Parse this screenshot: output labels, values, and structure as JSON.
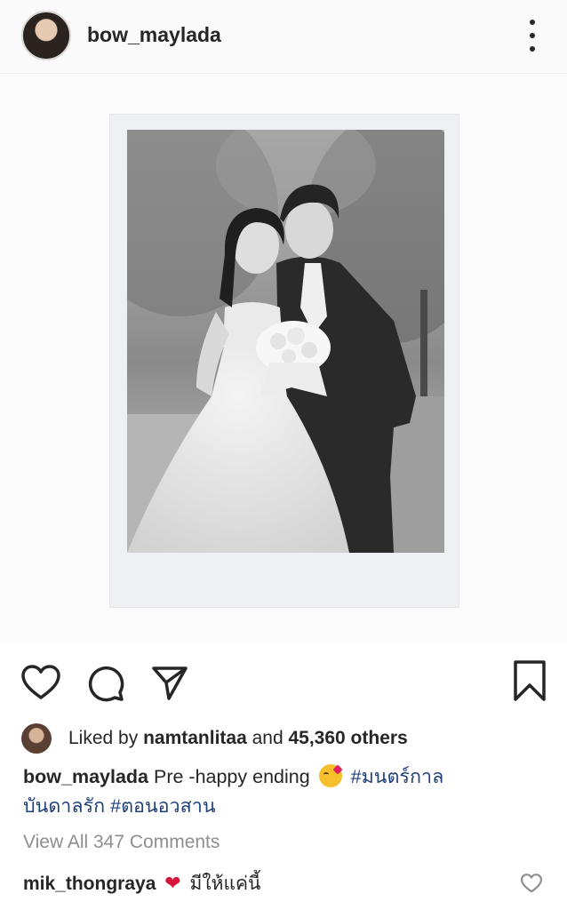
{
  "header": {
    "username": "bow_maylada"
  },
  "icons": {
    "more": "more-vertical-icon",
    "like": "heart-icon",
    "comment": "comment-icon",
    "share": "paper-plane-icon",
    "save": "bookmark-icon"
  },
  "likes": {
    "prefix": "Liked by ",
    "liker": "namtanlitaa",
    "middle": " and ",
    "count": "45,360 others"
  },
  "caption": {
    "username": "bow_maylada",
    "text": " Pre -happy ending ",
    "hashtags": [
      "#มนตร์กาลบันดาลรัก",
      "#ตอนอวสาน"
    ],
    "hashtag1_line1": "#มนตร์กาล",
    "hashtag1_line2": "บันดาลรัก",
    "hashtag2": "#ตอนอวสาน"
  },
  "comments": {
    "view_all": "View All 347 Comments",
    "items": [
      {
        "username": "mik_thongraya",
        "text": "มีให้แค่นี้"
      }
    ]
  },
  "colors": {
    "hashtag": "#1f3f79",
    "muted": "#8e8e8e",
    "text": "#262626"
  }
}
